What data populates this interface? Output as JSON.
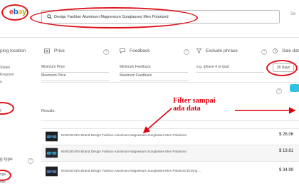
{
  "header": {
    "logo": {
      "e1": "e",
      "b": "b",
      "a": "a",
      "y": "y"
    },
    "search_value": "Design Fashion Aluminum Magnesium Sunglasses Men Polarized",
    "top_right_text": "Se"
  },
  "filters": {
    "shipping_location_label": "ping location",
    "price_label": "Price",
    "feedback_label": "Feedback",
    "exclude_label": "Exclude phrase",
    "sale_date_label": "Sale dat",
    "min_price_placeholder": "Minimum Price",
    "max_price_placeholder": "Maximum Price",
    "min_feedback_placeholder": "Minimum Feedback",
    "max_feedback_placeholder": "Maximum Feedback",
    "exclude_placeholder": "e.g. iphone 4 or ipad",
    "days_value": "30 Days",
    "help_icon": "?"
  },
  "sidebar": {
    "items": [
      "",
      "States",
      "Kingdom",
      "a",
      "",
      "",
      "",
      "y"
    ],
    "listing_type_label": "g type",
    "listing_items": [
      "nge",
      "rice"
    ]
  },
  "results": {
    "label": "Results:",
    "rows": [
      {
        "title": "KINGSEVEN Brand Design Fashion Aluminum Magnesium Sunglasses Men Polarized",
        "price": "$ 26.06"
      },
      {
        "title": "KINGSEVEN Brand Design Fashion Aluminum Magnesium Sunglasses Men Polarized",
        "price": "$ 19.81"
      },
      {
        "title": "KINGSEVEN Brand Design Fashion Aluminum Magnesium Sunglasses Men Polarized Driving ...",
        "price": "$ 34.99"
      }
    ]
  },
  "annotation": {
    "text": "Filter sampai\nada data",
    "color": "#e00010"
  },
  "colors": {
    "accent_red": "#e0141e",
    "toggle": "#2ec4e0"
  }
}
